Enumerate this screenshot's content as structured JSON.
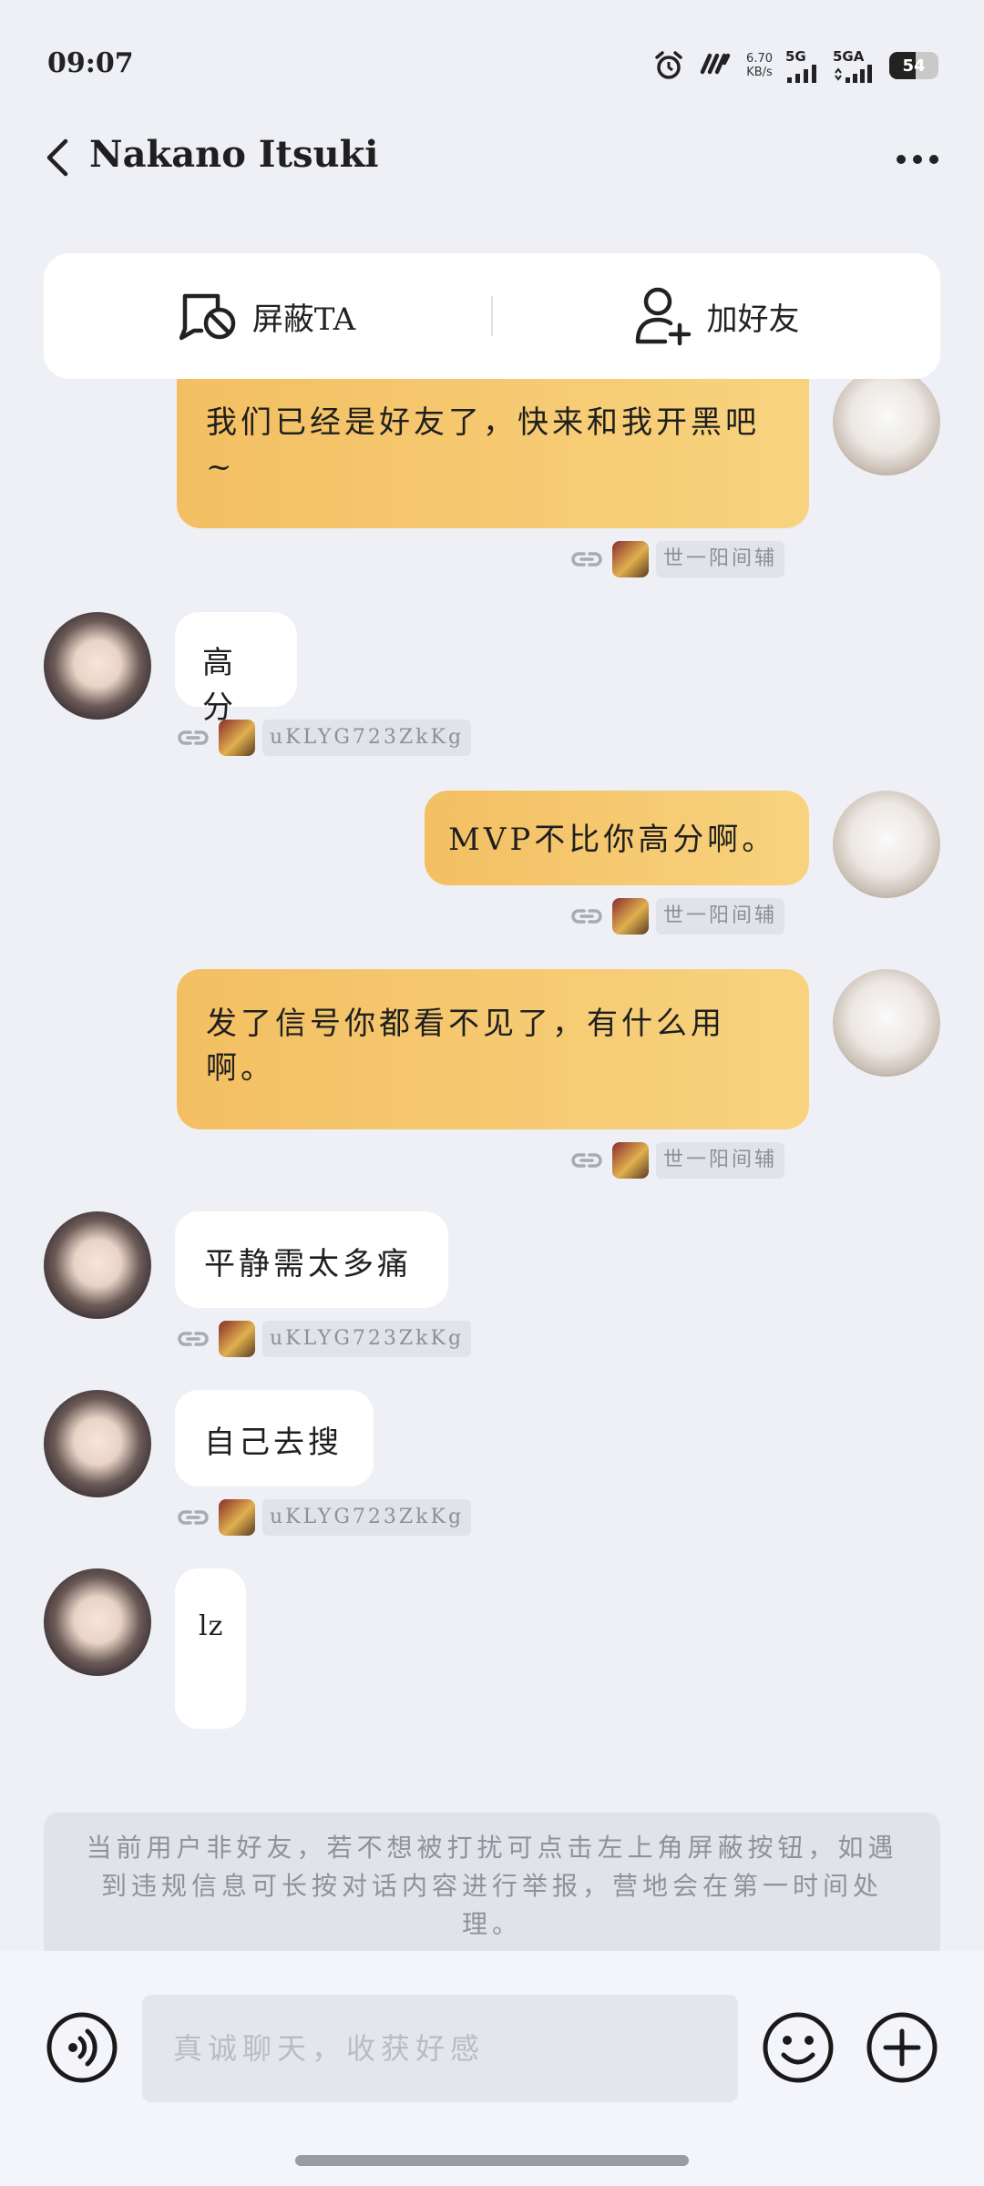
{
  "status_bar": {
    "time": "09:07",
    "speed_value": "6.70",
    "speed_unit": "KB/s",
    "net1": "5G",
    "net2": "5GA",
    "battery": "54",
    "battery_level": 0.54
  },
  "header": {
    "title": "Nakano Itsuki"
  },
  "actions": {
    "block_label": "屏蔽TA",
    "add_friend_label": "加好友"
  },
  "messages": [
    {
      "side": "out",
      "text": "我们已经是好友了，快来和我开黑吧~",
      "tag": "世一阳间辅"
    },
    {
      "side": "in",
      "text": "高分",
      "tag": "uKLYG723ZkKg"
    },
    {
      "side": "out",
      "text": "MVP不比你高分啊。",
      "tag": "世一阳间辅"
    },
    {
      "side": "out",
      "text": "发了信号你都看不见了，有什么用啊。",
      "tag": "世一阳间辅"
    },
    {
      "side": "in",
      "text": "平静需太多痛",
      "tag": "uKLYG723ZkKg"
    },
    {
      "side": "in",
      "text": "自己去搜",
      "tag": "uKLYG723ZkKg"
    },
    {
      "side": "in",
      "text": "lz"
    }
  ],
  "notice": "当前用户非好友，若不想被打扰可点击左上角屏蔽按钮，如遇到违规信息可长按对话内容进行举报，营地会在第一时间处理。",
  "input": {
    "placeholder": "真诚聊天，收获好感"
  },
  "colors": {
    "outgoing_bubble": "#f5c66a",
    "incoming_bubble": "#ffffff",
    "background": "#eef0f6"
  }
}
